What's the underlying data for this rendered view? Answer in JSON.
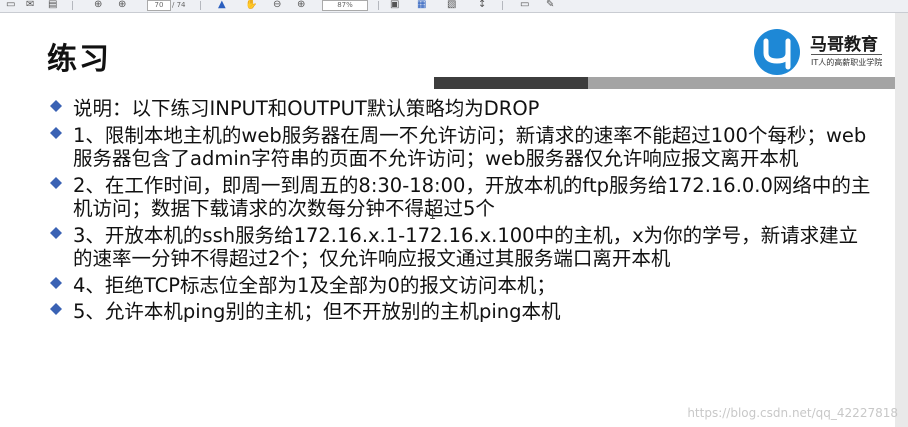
{
  "toolbar": {
    "page_current": "70",
    "page_total": "/ 74",
    "zoom": "87%",
    "icons": [
      "save-icon",
      "mail-icon",
      "up-icon",
      "down-icon",
      "select-icon",
      "hand-icon",
      "zoom-out-icon",
      "zoom-in-icon",
      "copy-icon",
      "fit-icon",
      "rotate-icon",
      "scroll-icon",
      "comment-icon",
      "pen-icon"
    ]
  },
  "slide": {
    "title": "练习",
    "logo": {
      "name": "马哥教育",
      "tagline": "IT人的高薪职业学院",
      "brand_color": "#1e88d6"
    },
    "bullet_color": "#3a62b4",
    "items": [
      "说明：以下练习INPUT和OUTPUT默认策略均为DROP",
      "1、限制本地主机的web服务器在周一不允许访问；新请求的速率不能超过100个每秒；web服务器包含了admin字符串的页面不允许访问；web服务器仅允许响应报文离开本机",
      "2、在工作时间，即周一到周五的8:30-18:00，开放本机的ftp服务给172.16.0.0网络中的主机访问；数据下载请求的次数每分钟不得超过5个",
      "3、开放本机的ssh服务给172.16.x.1-172.16.x.100中的主机，x为你的学号，新请求建立的速率一分钟不得超过2个；仅允许响应报文通过其服务端口离开本机",
      "4、拒绝TCP标志位全部为1及全部为0的报文访问本机；",
      "5、允许本机ping别的主机；但不开放别的主机ping本机"
    ]
  },
  "watermark": "https://blog.csdn.net/qq_42227818"
}
